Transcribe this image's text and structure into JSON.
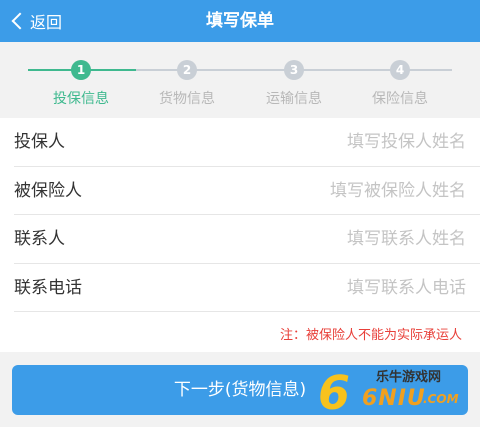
{
  "navbar": {
    "back_label": "返回",
    "title": "填写保单",
    "color": "#3c9ce8"
  },
  "steps": [
    {
      "number": "1",
      "label": "投保信息",
      "state": "active"
    },
    {
      "number": "2",
      "label": "货物信息",
      "state": "inactive"
    },
    {
      "number": "3",
      "label": "运输信息",
      "state": "inactive"
    },
    {
      "number": "4",
      "label": "保险信息",
      "state": "inactive"
    }
  ],
  "form": {
    "rows": [
      {
        "label": "投保人",
        "placeholder": "填写投保人姓名",
        "value": ""
      },
      {
        "label": "被保险人",
        "placeholder": "填写被保险人姓名",
        "value": ""
      },
      {
        "label": "联系人",
        "placeholder": "填写联系人姓名",
        "value": ""
      },
      {
        "label": "联系电话",
        "placeholder": "填写联系人电话",
        "value": ""
      }
    ],
    "note": "注：被保险人不能为实际承运人"
  },
  "next_button": {
    "label": "下一步(货物信息)"
  },
  "watermark": {
    "site_name": "乐牛游戏网",
    "logo_text": "6NIU",
    "logo_suffix": ".COM"
  },
  "colors": {
    "accent": "#3c9ce8",
    "active_step": "#3fb98f",
    "inactive_step": "#c9cfd6",
    "note": "#e8403a"
  }
}
